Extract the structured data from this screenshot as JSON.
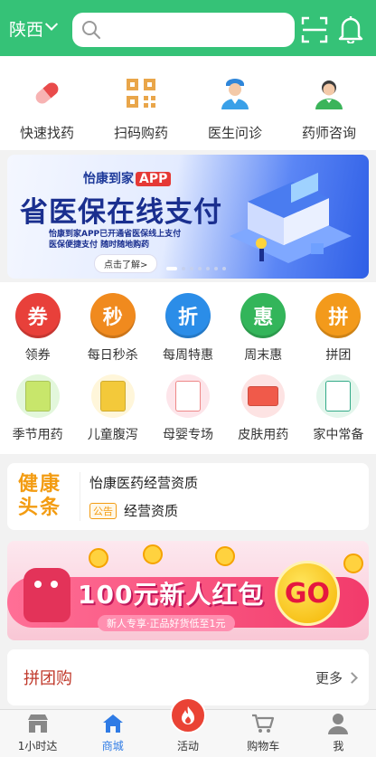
{
  "header": {
    "region": "陕西",
    "search_placeholder": "",
    "scan_icon": "scan-icon",
    "bell_icon": "bell-icon",
    "bg_color": "#35c277"
  },
  "top_services": [
    {
      "label": "快速找药",
      "icon": "pill-icon"
    },
    {
      "label": "扫码购药",
      "icon": "qr-code-icon"
    },
    {
      "label": "医生问诊",
      "icon": "doctor-icon"
    },
    {
      "label": "药师咨询",
      "icon": "pharmacist-icon"
    }
  ],
  "banner": {
    "brand": "怡康到家",
    "brand_tag": "APP",
    "headline": "省医保在线支付",
    "sub_line1": "怡康到家APP已开通省医保线上支付",
    "sub_line2": "医保便捷支付 随时随地购药",
    "learn_more": "点击了解>",
    "dots": 7,
    "active_dot": 0
  },
  "categories_row1": [
    {
      "label": "领券",
      "glyph": "券",
      "color": "#e8403a"
    },
    {
      "label": "每日秒杀",
      "glyph": "秒",
      "color": "#f08a1e"
    },
    {
      "label": "每周特惠",
      "glyph": "折",
      "color": "#2b8de8"
    },
    {
      "label": "周末惠",
      "glyph": "惠",
      "color": "#33b55a"
    },
    {
      "label": "拼团",
      "glyph": "拼",
      "color": "#f39a1b"
    }
  ],
  "categories_row2": [
    {
      "label": "季节用药",
      "color": "#e3f7dc",
      "box": "#c8e66b"
    },
    {
      "label": "儿童腹泻",
      "color": "#fff6da",
      "box": "#f3c93a"
    },
    {
      "label": "母婴专场",
      "color": "#fde5ea",
      "box": "#ffffff"
    },
    {
      "label": "皮肤用药",
      "color": "#fde3e3",
      "box": "#f05a4a"
    },
    {
      "label": "家中常备",
      "color": "#e3f6ec",
      "box": "#ffffff"
    }
  ],
  "news": {
    "logo_line1": "健康",
    "logo_line2": "头条",
    "headline": "怡康医药经营资质",
    "tag": "公告",
    "item": "经营资质"
  },
  "promo": {
    "title": "100元新人红包",
    "go": "GO",
    "slogan": "新人专享·正品好货低至1元"
  },
  "group_buy": {
    "title": "拼团购",
    "more": "更多"
  },
  "tabbar": [
    {
      "label": "1小时达",
      "icon": "store-icon",
      "active": false
    },
    {
      "label": "商城",
      "icon": "home-icon",
      "active": true
    },
    {
      "label": "活动",
      "icon": "fire-icon",
      "active": false
    },
    {
      "label": "购物车",
      "icon": "cart-icon",
      "active": false
    },
    {
      "label": "我",
      "icon": "user-icon",
      "active": false
    }
  ]
}
